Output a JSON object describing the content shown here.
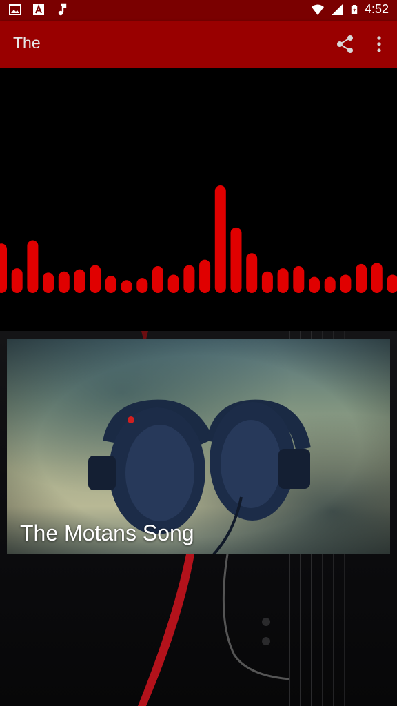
{
  "status_bar": {
    "time": "4:52",
    "icons": [
      "image-icon",
      "font-a-icon",
      "music-note-icon",
      "wifi-icon",
      "cell-signal-icon",
      "battery-icon"
    ]
  },
  "app_bar": {
    "title": "The",
    "actions": [
      "share-icon",
      "more-vert-icon"
    ]
  },
  "visualizer": {
    "bar_color": "#e00000",
    "levels": [
      0.46,
      0.23,
      0.49,
      0.19,
      0.2,
      0.22,
      0.26,
      0.16,
      0.12,
      0.14,
      0.25,
      0.17,
      0.26,
      0.31,
      1.0,
      0.61,
      0.37,
      0.2,
      0.23,
      0.25,
      0.15,
      0.15,
      0.17,
      0.27,
      0.28,
      0.17
    ]
  },
  "song_card": {
    "title": "The Motans Song"
  },
  "colors": {
    "status_bar": "#7a0000",
    "app_bar": "#990000",
    "accent": "#e00000"
  }
}
